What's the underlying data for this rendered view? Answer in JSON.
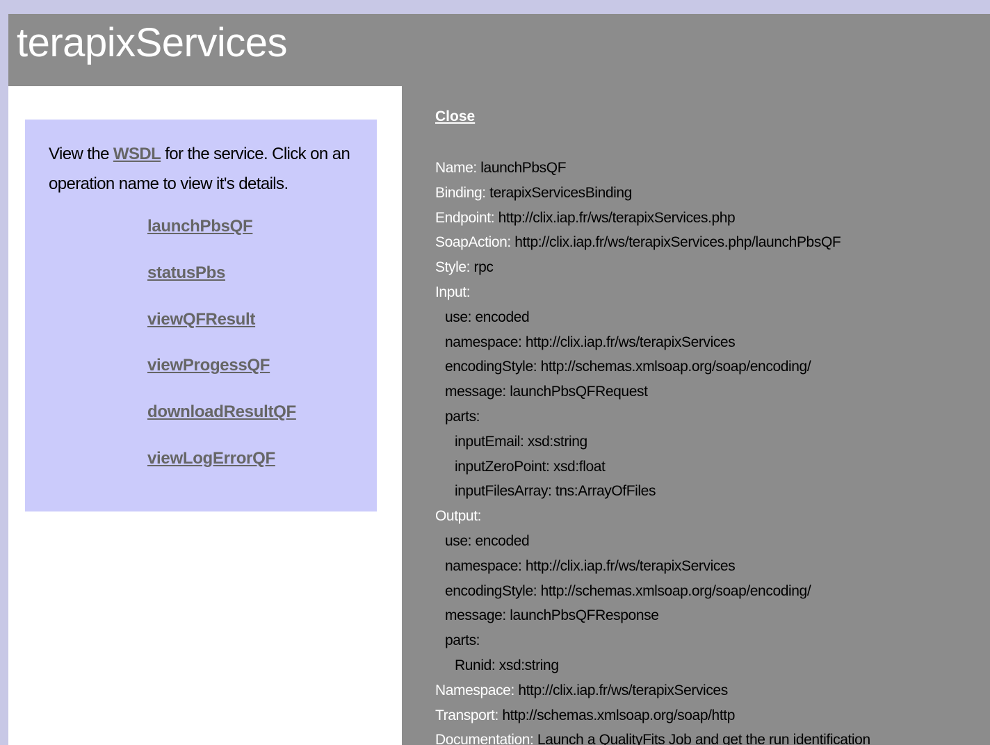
{
  "header": {
    "title": "terapixServices"
  },
  "nav": {
    "intro_before": "View the ",
    "wsdl_link": "WSDL",
    "intro_after": " for the service. Click on an operation name to view it's details.",
    "operations": [
      "launchPbsQF",
      "statusPbs",
      "viewQFResult",
      "viewProgessQF",
      "downloadResultQF",
      "viewLogErrorQF"
    ]
  },
  "details": {
    "close_label": "Close",
    "name_label": "Name:",
    "name_value": " launchPbsQF",
    "binding_label": "Binding:",
    "binding_value": " terapixServicesBinding",
    "endpoint_label": "Endpoint:",
    "endpoint_value": " http://clix.iap.fr/ws/terapixServices.php",
    "soapaction_label": "SoapAction:",
    "soapaction_value": " http://clix.iap.fr/ws/terapixServices.php/launchPbsQF",
    "style_label": "Style:",
    "style_value": " rpc",
    "input_label": "Input:",
    "input": {
      "use": "use: encoded",
      "namespace": "namespace: http://clix.iap.fr/ws/terapixServices",
      "encoding_style": "encodingStyle: http://schemas.xmlsoap.org/soap/encoding/",
      "message": "message: launchPbsQFRequest",
      "parts_label": "parts:",
      "parts": [
        "inputEmail: xsd:string",
        "inputZeroPoint: xsd:float",
        "inputFilesArray: tns:ArrayOfFiles"
      ]
    },
    "output_label": "Output:",
    "output": {
      "use": "use: encoded",
      "namespace": "namespace: http://clix.iap.fr/ws/terapixServices",
      "encoding_style": "encodingStyle: http://schemas.xmlsoap.org/soap/encoding/",
      "message": "message: launchPbsQFResponse",
      "parts_label": "parts:",
      "parts": [
        "Runid: xsd:string"
      ]
    },
    "namespace_label": "Namespace:",
    "namespace_value": " http://clix.iap.fr/ws/terapixServices",
    "transport_label": "Transport:",
    "transport_value": " http://schemas.xmlsoap.org/soap/http",
    "documentation_label": "Documentation:",
    "documentation_value": " Launch a QualityFits Job and get the run identification"
  }
}
